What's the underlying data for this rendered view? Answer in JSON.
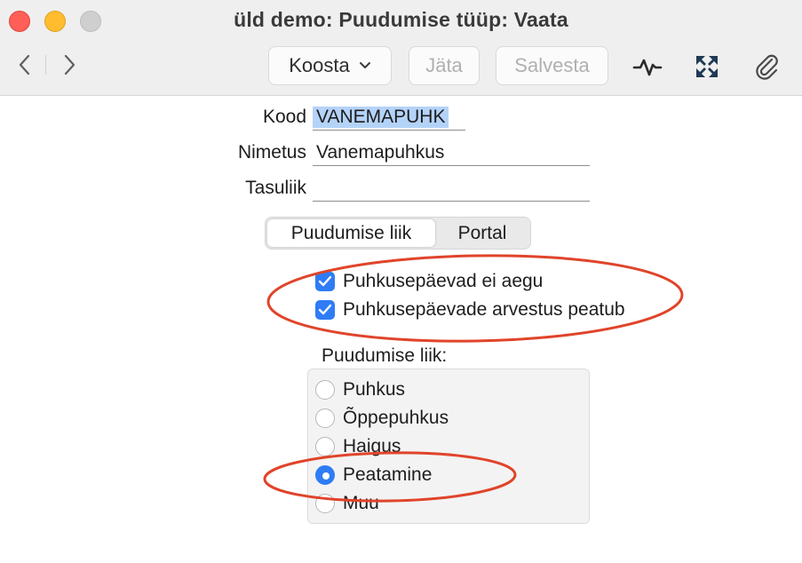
{
  "window": {
    "title": "üld demo: Puudumise tüüp: Vaata"
  },
  "toolbar": {
    "back_icon": "chevron-left-icon",
    "forward_icon": "chevron-right-icon",
    "koosta_label": "Koosta",
    "jata_label": "Jäta",
    "salvesta_label": "Salvesta",
    "icons": [
      "activity-icon",
      "expand-icon",
      "paperclip-icon"
    ]
  },
  "form": {
    "kood_label": "Kood",
    "kood_value": "VANEMAPUHK",
    "nimetus_label": "Nimetus",
    "nimetus_value": "Vanemapuhkus",
    "tasuliik_label": "Tasuliik",
    "tasuliik_value": ""
  },
  "tabs": {
    "active": "Puudumise liik",
    "other": "Portal"
  },
  "checkboxes": [
    {
      "label": "Puhkusepäevad ei aegu",
      "checked": true
    },
    {
      "label": "Puhkusepäevade arvestus peatub",
      "checked": true
    }
  ],
  "radio_group": {
    "title": "Puudumise liik:",
    "options": [
      {
        "label": "Puhkus",
        "selected": false
      },
      {
        "label": "Õppepuhkus",
        "selected": false
      },
      {
        "label": "Haigus",
        "selected": false
      },
      {
        "label": "Peatamine",
        "selected": true
      },
      {
        "label": "Muu",
        "selected": false
      }
    ]
  },
  "colors": {
    "accent": "#2f7cf6",
    "annotation": "#e0442a",
    "selection": "#b4d3f8"
  }
}
